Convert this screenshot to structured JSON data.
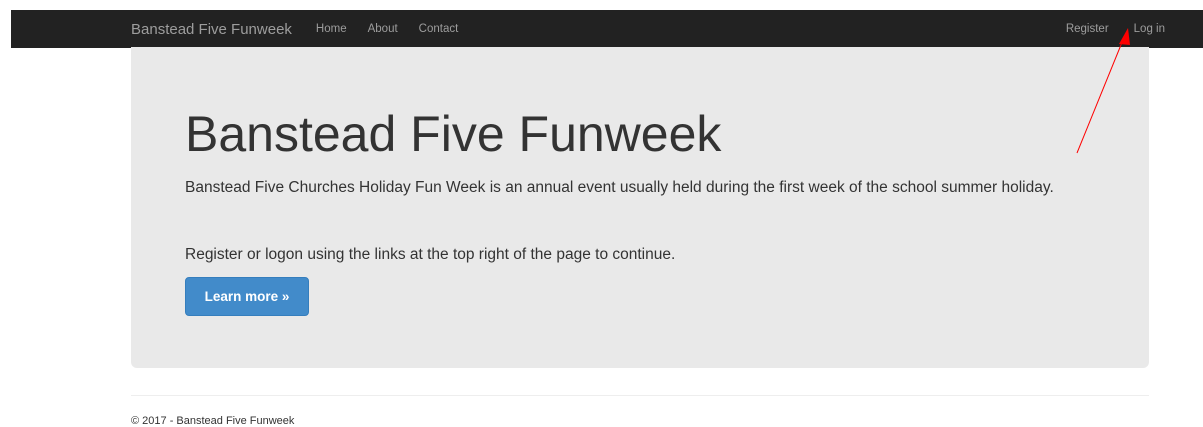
{
  "navbar": {
    "brand": "Banstead Five Funweek",
    "links": [
      "Home",
      "About",
      "Contact"
    ],
    "register_label": "Register",
    "login_label": "Log in"
  },
  "jumbotron": {
    "title": "Banstead Five Funweek",
    "lead_1": "Banstead Five Churches Holiday Fun Week is an annual event usually held during the first week of the school summer holiday.",
    "lead_2": "Register or logon using the links at the top right of the page to continue.",
    "button_label": "Learn more »"
  },
  "footer": {
    "text": "© 2017 - Banstead Five Funweek"
  },
  "colors": {
    "navbar_bg": "#222222",
    "jumbotron_bg": "#e9e9e9",
    "primary": "#428bca",
    "annotation_arrow": "#ff0000"
  }
}
